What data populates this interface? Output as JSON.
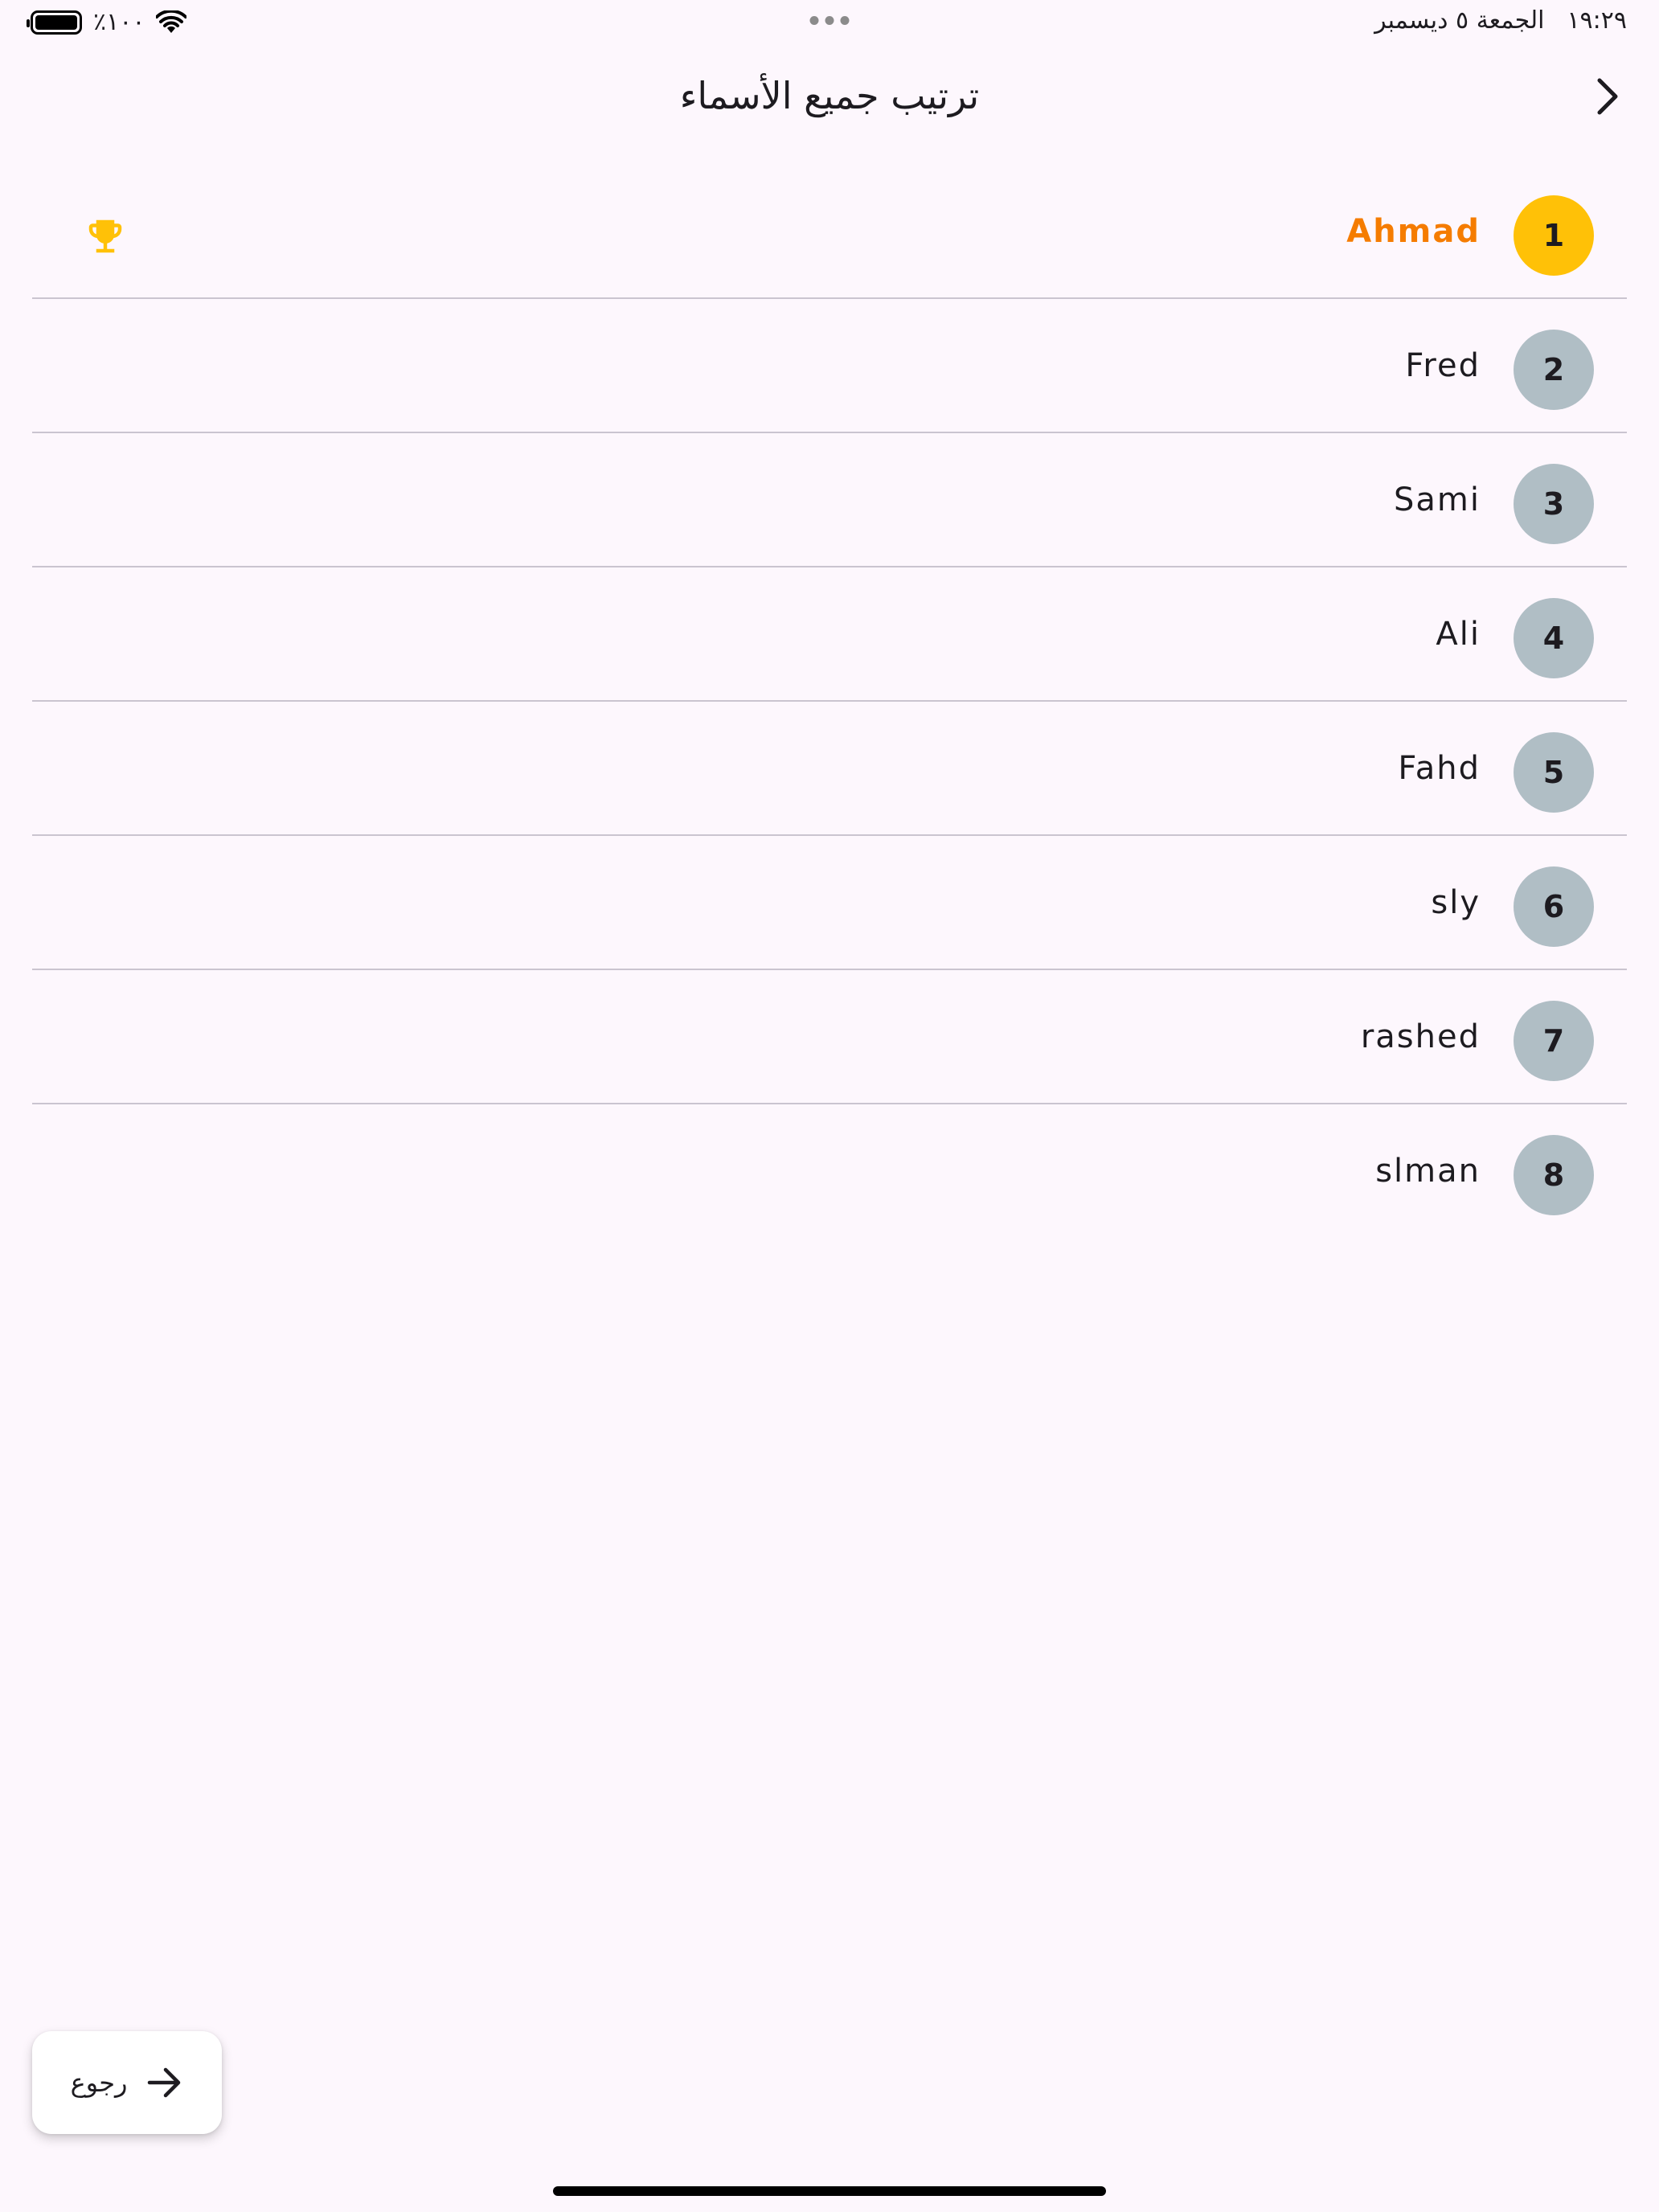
{
  "status_bar": {
    "time": "١٩:٢٩",
    "date": "الجمعة ٥ ديسمبر",
    "battery": "٪١٠٠"
  },
  "app_bar": {
    "title": "ترتيب جميع الأسماء"
  },
  "ranking": [
    {
      "rank": "1",
      "name": "Ahmad"
    },
    {
      "rank": "2",
      "name": "Fred"
    },
    {
      "rank": "3",
      "name": "Sami"
    },
    {
      "rank": "4",
      "name": "Ali"
    },
    {
      "rank": "5",
      "name": "Fahd"
    },
    {
      "rank": "6",
      "name": "sly"
    },
    {
      "rank": "7",
      "name": "rashed"
    },
    {
      "rank": "8",
      "name": "slman"
    }
  ],
  "back_button": {
    "label": "رجوع"
  },
  "colors": {
    "background": "#fdf7fd",
    "gold": "#ffc107",
    "first_name": "#f57c00",
    "badge_grey": "#b0bec5",
    "divider": "#cac4d0"
  },
  "icons": {
    "first_place": "trophy-icon",
    "header_nav": "chevron-right-icon",
    "back_button": "arrow-right-icon"
  }
}
